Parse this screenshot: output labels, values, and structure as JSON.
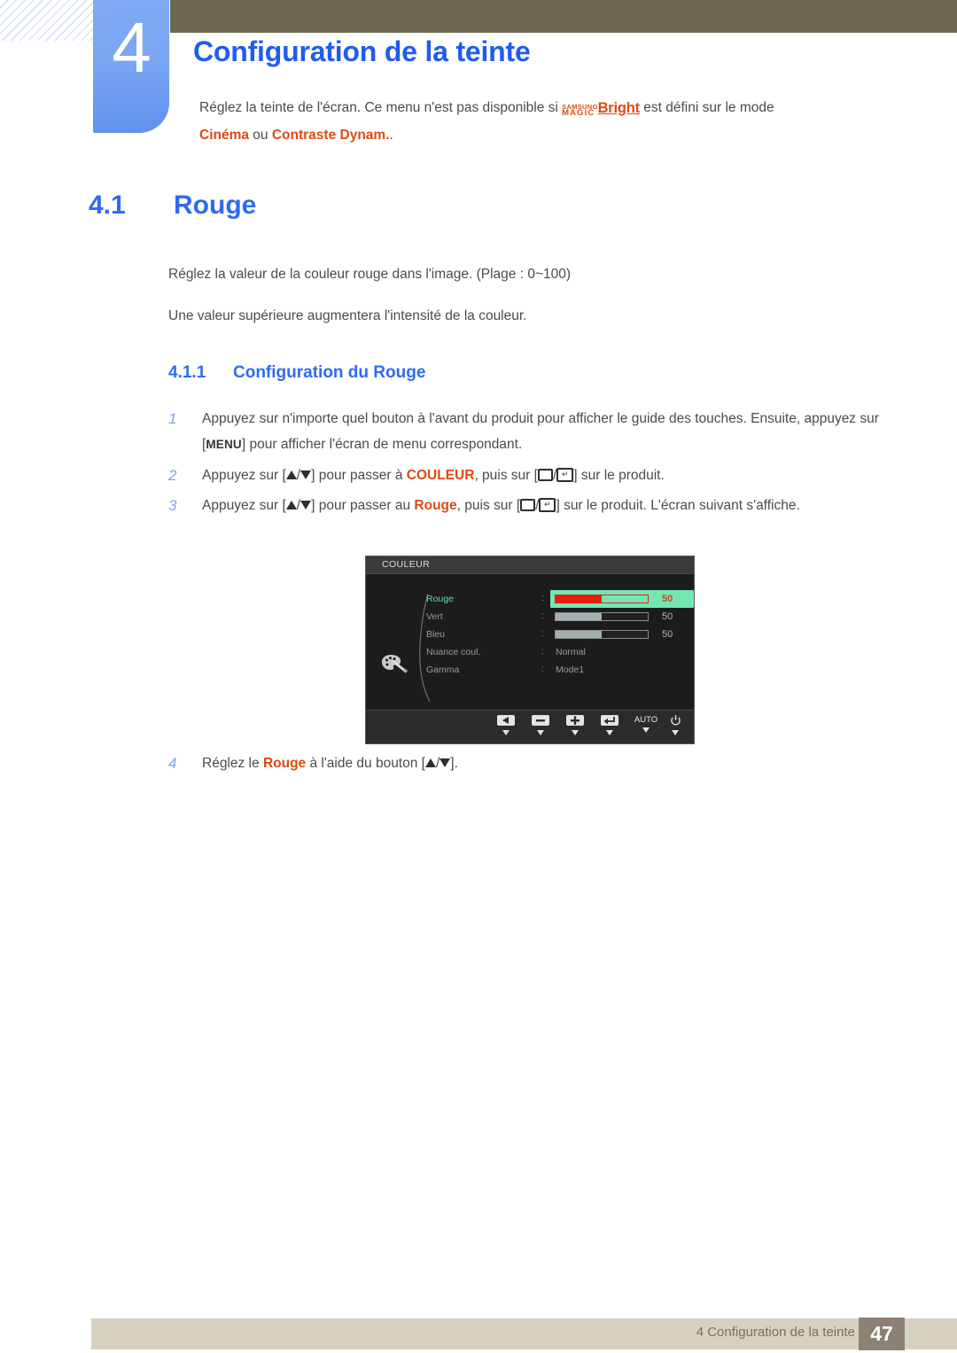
{
  "chapter": {
    "number": "4",
    "title": "Configuration de la teinte",
    "intro_before": "Réglez la teinte de l'écran. Ce menu n'est pas disponible si ",
    "logo_line1": "SAMSUNG",
    "logo_line2": "MAGIC",
    "logo_bright": "Bright",
    "intro_after": " est défini sur le mode",
    "intro_line2_a": "Cinéma",
    "intro_line2_b": " ou ",
    "intro_line2_c": "Contraste Dynam.",
    "intro_line2_d": "."
  },
  "section": {
    "number": "4.1",
    "title": "Rouge",
    "paragraph1": "Réglez la valeur de la couleur rouge dans l'image. (Plage : 0~100)",
    "paragraph2": "Une valeur supérieure augmentera l'intensité de la couleur."
  },
  "subsection": {
    "number": "4.1.1",
    "title": "Configuration du Rouge"
  },
  "steps": [
    {
      "index": "1",
      "part1": "Appuyez sur n'importe quel bouton à l'avant du produit pour afficher le guide des touches. Ensuite, appuyez sur [",
      "key": "MENU",
      "part2": "] pour afficher l'écran de menu correspondant."
    },
    {
      "index": "2",
      "part1": "Appuyez sur [",
      "part2": "] pour passer à ",
      "target": "COULEUR",
      "part3": ", puis sur [",
      "part4": "] sur le produit."
    },
    {
      "index": "3",
      "part1": "Appuyez sur [",
      "part2": "] pour passer au ",
      "target": "Rouge",
      "part3": ", puis sur [",
      "part4": "] sur le produit. L'écran suivant s'affiche."
    },
    {
      "index": "4",
      "part1": "Réglez le ",
      "target": "Rouge",
      "part2": " à l'aide du bouton [",
      "part3": "]."
    }
  ],
  "osd": {
    "title": "COULEUR",
    "rows": [
      {
        "label": "Rouge",
        "value": "50",
        "type": "slider",
        "fill": 50,
        "selected": true
      },
      {
        "label": "Vert",
        "value": "50",
        "type": "slider",
        "fill": 50,
        "selected": false
      },
      {
        "label": "Bleu",
        "value": "50",
        "type": "slider",
        "fill": 50,
        "selected": false
      },
      {
        "label": "Nuance coul.",
        "value": "Normal",
        "type": "text",
        "selected": false
      },
      {
        "label": "Gamma",
        "value": "Mode1",
        "type": "text",
        "selected": false
      }
    ],
    "buttons": [
      "left-arrow",
      "minus",
      "plus",
      "enter",
      "AUTO",
      "power"
    ],
    "auto_label": "AUTO"
  },
  "footer": {
    "text": "4 Configuration de la teinte",
    "page": "47"
  },
  "colors": {
    "accent_blue": "#2e6bf2",
    "accent_orange": "#e04a12",
    "olive": "#6b6751",
    "tab_blue": "#6f9cf1",
    "footer_bar": "#d6d2bf",
    "page_box": "#8d8175",
    "osd_highlight": "#74e6b4",
    "osd_red": "#ed1c10"
  }
}
